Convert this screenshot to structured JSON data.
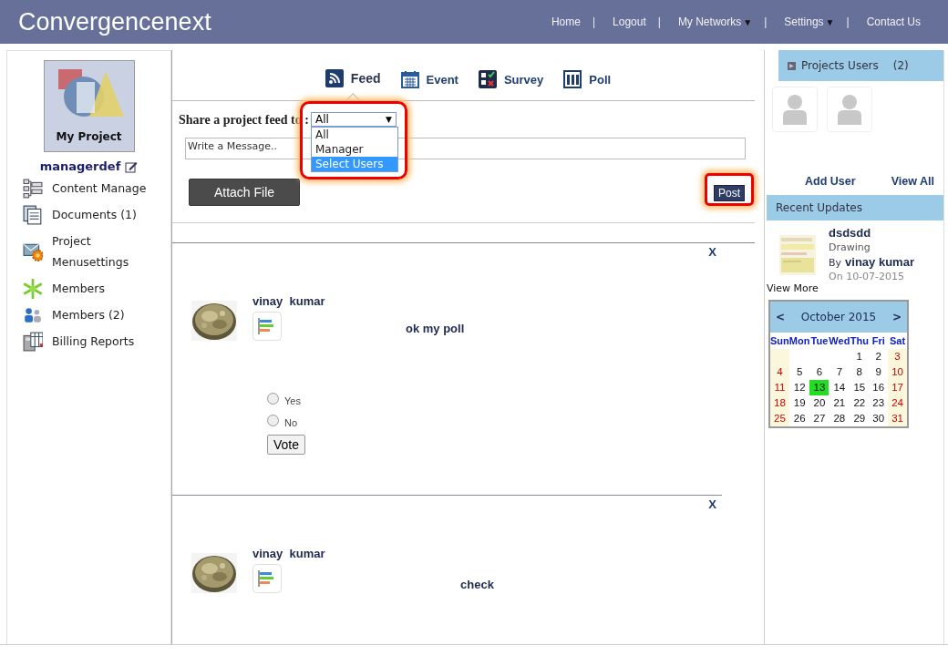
{
  "header": {
    "logo": "Convergencenext",
    "nav": [
      {
        "label": "Home",
        "separator": "|"
      },
      {
        "label": "Logout",
        "separator": "|"
      },
      {
        "label": "My Networks",
        "caret": "▼",
        "separator": "|"
      },
      {
        "label": "Settings",
        "caret": "▼",
        "separator": "|"
      },
      {
        "label": "Contact Us"
      }
    ]
  },
  "sidebar": {
    "project": "My Project",
    "user": "managerdef",
    "items": [
      {
        "label": "Content Manage"
      },
      {
        "label": "Documents (1)"
      },
      {
        "label": "Project Menusettings"
      },
      {
        "label": "Members"
      },
      {
        "label": "Members (2)"
      },
      {
        "label": "Billing Reports"
      }
    ]
  },
  "tabs": [
    {
      "label": "Feed",
      "selected": true
    },
    {
      "label": "Event",
      "selected": false
    },
    {
      "label": "Survey",
      "selected": false
    },
    {
      "label": "Poll",
      "selected": false
    }
  ],
  "share": {
    "label": "Share a project feed to :",
    "value": "All",
    "caret": "▼",
    "options": [
      {
        "label": "All",
        "highlighted": false
      },
      {
        "label": "Manager",
        "highlighted": false
      },
      {
        "label": "Select Users",
        "highlighted": true
      }
    ]
  },
  "message": {
    "placeholder": "Write a Message.."
  },
  "attach_button": "Attach File",
  "post_button": "Post",
  "posts": [
    {
      "close": "X",
      "author": "vinay  kumar",
      "text": "ok my poll",
      "options": [
        {
          "label": "Yes",
          "checked": false
        },
        {
          "label": "No",
          "checked": false
        }
      ],
      "vote": "Vote"
    },
    {
      "close": "X",
      "author": "vinay  kumar",
      "text": "check"
    }
  ],
  "users_panel": {
    "title": "Projects Users",
    "count": "(2)",
    "avatars": [
      {
        "kind": "placeholder"
      },
      {
        "kind": "placeholder"
      }
    ],
    "add": "Add User",
    "view_all": "View All"
  },
  "recent": {
    "title": "Recent Updates",
    "items": [
      {
        "title": "dsdsdd",
        "type": "Drawing",
        "by": "By",
        "author": "vinay kumar",
        "date": "On 10-07-2015"
      }
    ],
    "more": "View More"
  },
  "calendar": {
    "prev": "<",
    "month": "October 2015",
    "next": ">",
    "weekdays": [
      "Sun",
      "Mon",
      "Tue",
      "Wed",
      "Thu",
      "Fri",
      "Sat"
    ],
    "weeks": [
      [
        {
          "kind": "blank"
        },
        {
          "kind": "blank"
        },
        {
          "kind": "blank"
        },
        {
          "kind": "blank"
        },
        {
          "kind": "day",
          "day": "1",
          "selected": false
        },
        {
          "kind": "day",
          "day": "2",
          "selected": false
        },
        {
          "kind": "day",
          "day": "3",
          "selected": false
        }
      ],
      [
        {
          "kind": "day",
          "day": "4",
          "selected": false
        },
        {
          "kind": "day",
          "day": "5",
          "selected": false
        },
        {
          "kind": "day",
          "day": "6",
          "selected": false
        },
        {
          "kind": "day",
          "day": "7",
          "selected": false
        },
        {
          "kind": "day",
          "day": "8",
          "selected": false
        },
        {
          "kind": "day",
          "day": "9",
          "selected": false
        },
        {
          "kind": "day",
          "day": "10",
          "selected": false
        }
      ],
      [
        {
          "kind": "day",
          "day": "11",
          "selected": false
        },
        {
          "kind": "day",
          "day": "12",
          "selected": false
        },
        {
          "kind": "day",
          "day": "13",
          "selected": true
        },
        {
          "kind": "day",
          "day": "14",
          "selected": false
        },
        {
          "kind": "day",
          "day": "15",
          "selected": false
        },
        {
          "kind": "day",
          "day": "16",
          "selected": false
        },
        {
          "kind": "day",
          "day": "17",
          "selected": false
        }
      ],
      [
        {
          "kind": "day",
          "day": "18",
          "selected": false
        },
        {
          "kind": "day",
          "day": "19",
          "selected": false
        },
        {
          "kind": "day",
          "day": "20",
          "selected": false
        },
        {
          "kind": "day",
          "day": "21",
          "selected": false
        },
        {
          "kind": "day",
          "day": "22",
          "selected": false
        },
        {
          "kind": "day",
          "day": "23",
          "selected": false
        },
        {
          "kind": "day",
          "day": "24",
          "selected": false
        }
      ],
      [
        {
          "kind": "day",
          "day": "25",
          "selected": false
        },
        {
          "kind": "day",
          "day": "26",
          "selected": false
        },
        {
          "kind": "day",
          "day": "27",
          "selected": false
        },
        {
          "kind": "day",
          "day": "28",
          "selected": false
        },
        {
          "kind": "day",
          "day": "29",
          "selected": false
        },
        {
          "kind": "day",
          "day": "30",
          "selected": false
        },
        {
          "kind": "day",
          "day": "31",
          "selected": false
        }
      ]
    ]
  }
}
